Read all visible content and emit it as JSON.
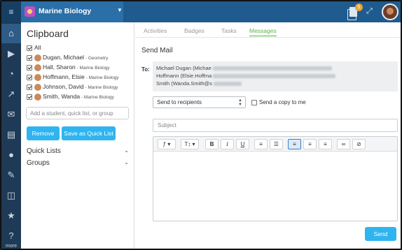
{
  "header": {
    "menu_icon": "hamburger-icon",
    "class_name": "Marine Biology",
    "notification_count": "5"
  },
  "nav": {
    "icons": [
      "home-icon",
      "play-icon",
      "dashboard-icon",
      "chart-icon",
      "mail-icon",
      "calendar-icon",
      "users-icon",
      "edit-icon",
      "documents-icon",
      "award-icon",
      "help-icon"
    ],
    "more_label": "more"
  },
  "clipboard": {
    "title": "Clipboard",
    "all_label": "All",
    "students": [
      {
        "name": "Dugan, Michael",
        "class": " - Geometry"
      },
      {
        "name": "Hall, Sharon",
        "class": " - Marine Biology"
      },
      {
        "name": "Hoffmann, Elsie",
        "class": " - Marine Biology"
      },
      {
        "name": "Johnson, David",
        "class": " - Marine Biology"
      },
      {
        "name": "Smith, Wanda",
        "class": " - Marine Biology"
      }
    ],
    "input_placeholder": "Add a student, quick list, or group",
    "remove_label": "Remove",
    "save_quicklist_label": "Save as Quick List",
    "quick_lists_label": "Quick Lists",
    "groups_label": "Groups"
  },
  "tabs": [
    "Activities",
    "Badges",
    "Tasks",
    "Messages"
  ],
  "active_tab": "Messages",
  "mail": {
    "title": "Send Mail",
    "to_label": "To:",
    "to_lines": [
      "Michael Dugan (Michae",
      "Hoffmann (Elsie.Hoffma",
      "Smith (Wanda.Smith@s"
    ],
    "recipient_select": "Send to recipients",
    "copy_label": "Send a copy to me",
    "subject_placeholder": "Subject",
    "send_label": "Send"
  },
  "toolbar": {
    "font_label": "ƒ ▾",
    "size_label": "T↕ ▾",
    "bold": "B",
    "italic": "I",
    "underline": "U"
  },
  "colors": {
    "accent": "#2fb4ef",
    "active_tab": "#5ab548",
    "topbar": "#1f5b8e",
    "nav": "#1f3a56"
  }
}
